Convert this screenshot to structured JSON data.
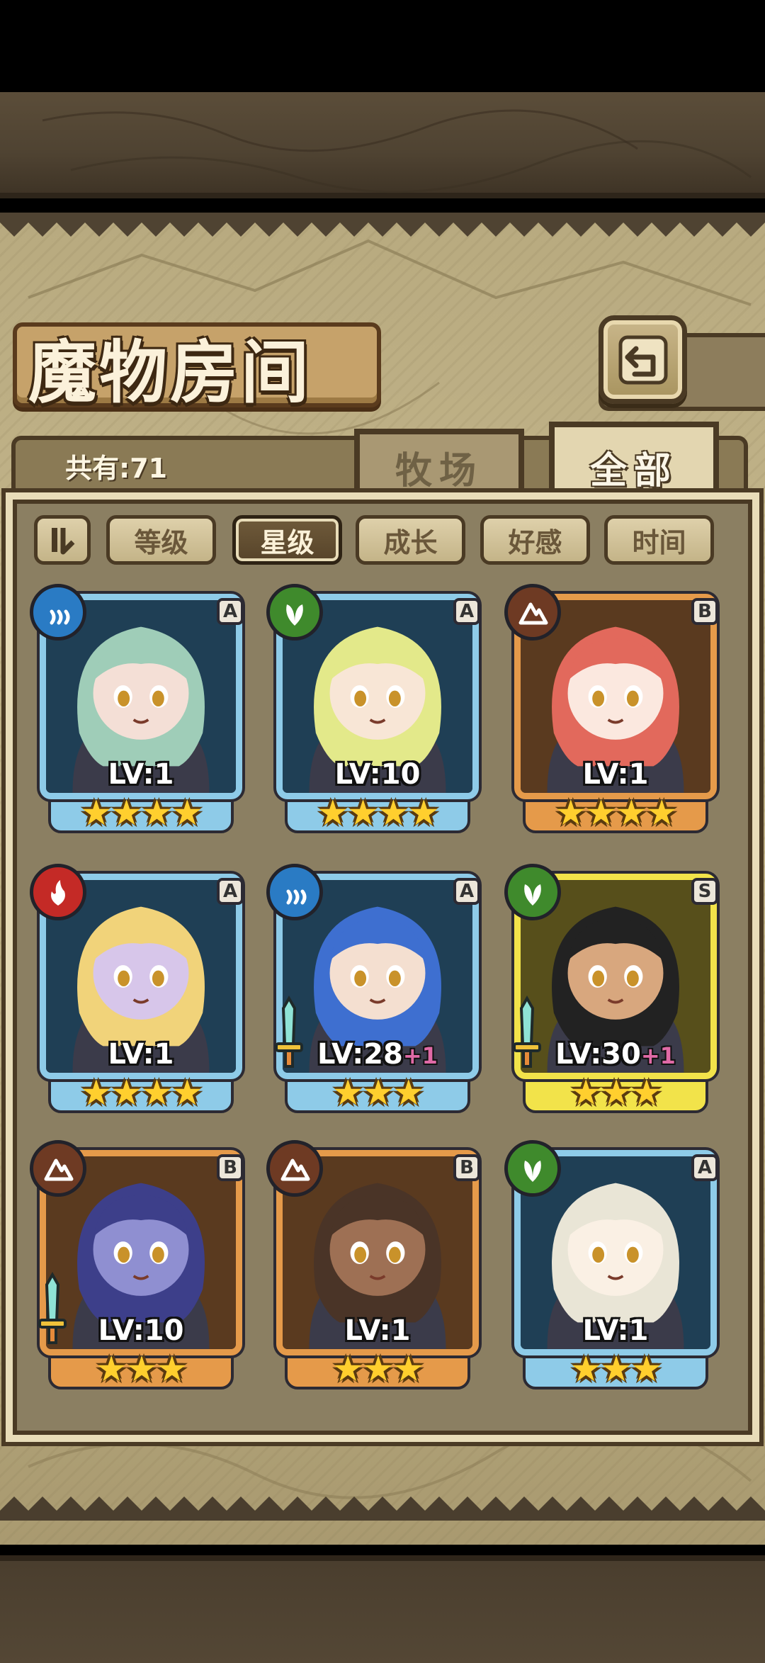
{
  "title": "魔物房间",
  "count_label": "共有:71",
  "tabs": {
    "ranch": "牧场",
    "all": "全部"
  },
  "sort_buttons": [
    "等级",
    "星级",
    "成长",
    "好感",
    "时间"
  ],
  "active_sort": "星级",
  "colors": {
    "frame_blue": "#8ecbe8",
    "frame_orange": "#e59a4a",
    "frame_yellow": "#f2e34a",
    "element_water": "#2a7bc4",
    "element_nature": "#3f8a2c",
    "element_fire": "#c42a26",
    "element_earth": "#6e3a23"
  },
  "cards": [
    {
      "rarity": "A",
      "element": "water-icon",
      "level": "LV:1",
      "plus": "",
      "stars": "★★★★",
      "frame": "blue",
      "weapon": false,
      "hair": "#9fcdb8",
      "skin": "#f4dfd6"
    },
    {
      "rarity": "A",
      "element": "leaf-icon",
      "level": "LV:10",
      "plus": "",
      "stars": "★★★★",
      "frame": "blue",
      "weapon": false,
      "hair": "#e3e98a",
      "skin": "#f8e6d6"
    },
    {
      "rarity": "B",
      "element": "earth-icon",
      "level": "LV:1",
      "plus": "",
      "stars": "★★★★",
      "frame": "orange",
      "weapon": false,
      "hair": "#e2695c",
      "skin": "#fbe8df"
    },
    {
      "rarity": "A",
      "element": "fire-icon",
      "level": "LV:1",
      "plus": "",
      "stars": "★★★★",
      "frame": "blue",
      "weapon": false,
      "hair": "#f1d37a",
      "skin": "#d7c6ea"
    },
    {
      "rarity": "A",
      "element": "water-icon",
      "level": "LV:28",
      "plus": "+1",
      "stars": "★★★",
      "frame": "blue",
      "weapon": true,
      "hair": "#3e6fd0",
      "skin": "#f4dfd0"
    },
    {
      "rarity": "S",
      "element": "leaf-icon",
      "level": "LV:30",
      "plus": "+1",
      "stars": "★★★",
      "frame": "yellow",
      "weapon": true,
      "hair": "#222222",
      "skin": "#d8a77e"
    },
    {
      "rarity": "B",
      "element": "earth-icon",
      "level": "LV:10",
      "plus": "",
      "stars": "★★★",
      "frame": "orange",
      "weapon": true,
      "hair": "#3d3f8a",
      "skin": "#8f8fd1"
    },
    {
      "rarity": "B",
      "element": "earth-icon",
      "level": "LV:1",
      "plus": "",
      "stars": "★★★",
      "frame": "orange",
      "weapon": false,
      "hair": "#4a3427",
      "skin": "#9e7054"
    },
    {
      "rarity": "A",
      "element": "leaf-icon",
      "level": "LV:1",
      "plus": "",
      "stars": "★★★",
      "frame": "blue",
      "weapon": false,
      "hair": "#e9e5d6",
      "skin": "#faf0e4"
    }
  ]
}
